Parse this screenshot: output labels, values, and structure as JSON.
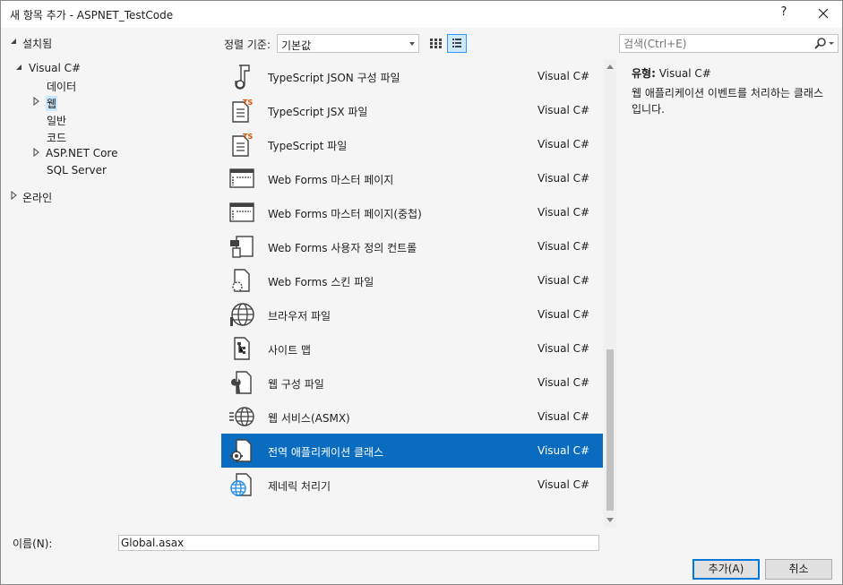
{
  "window": {
    "title": "새 항목 추가 - ASPNET_TestCode",
    "help_label": "?"
  },
  "tree": {
    "installed": "설치됨",
    "visual_csharp": "Visual C#",
    "data": "데이터",
    "web": "웹",
    "general": "일반",
    "code": "코드",
    "aspnet_core": "ASP.NET Core",
    "sql_server": "SQL Server",
    "online": "온라인"
  },
  "toolbar": {
    "sort_label": "정렬 기준:",
    "sort_value": "기본값",
    "search_placeholder": "검색(Ctrl+E)"
  },
  "items": [
    {
      "name": "TypeScript JSON 구성 파일",
      "lang": "Visual C#",
      "icon": "ts-json-config-icon"
    },
    {
      "name": "TypeScript JSX 파일",
      "lang": "Visual C#",
      "icon": "tsx-file-icon"
    },
    {
      "name": "TypeScript 파일",
      "lang": "Visual C#",
      "icon": "ts-file-icon"
    },
    {
      "name": "Web Forms 마스터 페이지",
      "lang": "Visual C#",
      "icon": "master-page-icon"
    },
    {
      "name": "Web Forms 마스터 페이지(중첩)",
      "lang": "Visual C#",
      "icon": "nested-master-page-icon"
    },
    {
      "name": "Web Forms 사용자 정의 컨트롤",
      "lang": "Visual C#",
      "icon": "user-control-icon"
    },
    {
      "name": "Web Forms 스킨 파일",
      "lang": "Visual C#",
      "icon": "skin-file-icon"
    },
    {
      "name": "브라우저 파일",
      "lang": "Visual C#",
      "icon": "browser-file-icon"
    },
    {
      "name": "사이트 맵",
      "lang": "Visual C#",
      "icon": "site-map-icon"
    },
    {
      "name": "웹 구성 파일",
      "lang": "Visual C#",
      "icon": "web-config-icon"
    },
    {
      "name": "웹 서비스(ASMX)",
      "lang": "Visual C#",
      "icon": "web-service-icon"
    },
    {
      "name": "전역 애플리케이션 클래스",
      "lang": "Visual C#",
      "icon": "global-app-class-icon",
      "selected": true
    },
    {
      "name": "제네릭 처리기",
      "lang": "Visual C#",
      "icon": "generic-handler-icon"
    }
  ],
  "details": {
    "type_label": "유형:",
    "type_value": "Visual C#",
    "description": "웹 애플리케이션 이벤트를 처리하는 클래스입니다."
  },
  "bottom": {
    "name_label": "이름(N):",
    "name_value": "Global.asax",
    "add_button": "추가(A)",
    "cancel_button": "취소"
  },
  "colors": {
    "selection": "#0a6cbf",
    "tree_selection": "#cce8ff",
    "accent": "#0078d7"
  }
}
